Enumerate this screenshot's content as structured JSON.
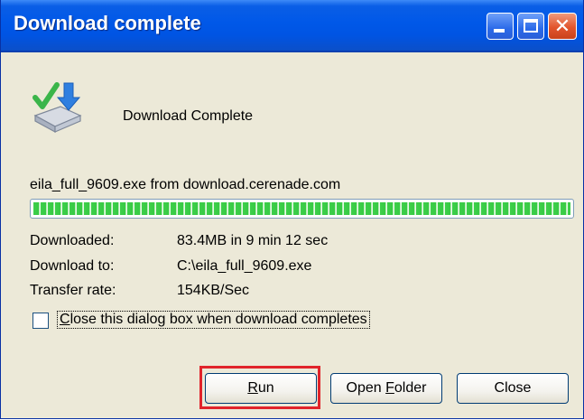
{
  "window": {
    "title": "Download complete"
  },
  "titlebar_buttons": {
    "close_glyph": "✕"
  },
  "header": {
    "label": "Download Complete",
    "icon": "download-complete-icon"
  },
  "download": {
    "source": "eila_full_9609.exe from download.cerenade.com",
    "progress_fraction": 1.0
  },
  "info": {
    "downloaded_label": "Downloaded:",
    "downloaded_value": "83.4MB in 9 min 12 sec",
    "download_to_label": "Download to:",
    "download_to_value": "C:\\eila_full_9609.exe",
    "transfer_rate_label": "Transfer rate:",
    "transfer_rate_value": "154KB/Sec"
  },
  "options": {
    "close_when_complete_label": "Close this dialog box when download completes",
    "close_when_complete_checked": false
  },
  "buttons": {
    "run": "Run",
    "open_folder": "Open Folder",
    "close": "Close"
  },
  "colors": {
    "titlebar": "#0054e3",
    "progress": "#37c944",
    "highlight": "#e1242b",
    "dialog_bg": "#ece9d8"
  }
}
